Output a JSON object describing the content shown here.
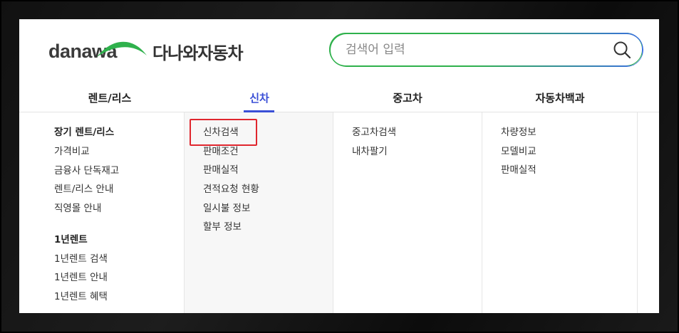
{
  "brand": {
    "logo_text": "danawa",
    "service_name": "다나와자동차",
    "swoosh_color": "#2fb14c"
  },
  "search": {
    "placeholder": "검색어 입력",
    "value": "",
    "icon": "search-icon",
    "border_colors": [
      "#2fb14c",
      "#3a6fe0"
    ]
  },
  "nav": {
    "tabs": [
      {
        "label": "렌트/리스",
        "active": false
      },
      {
        "label": "신차",
        "active": true
      },
      {
        "label": "중고차",
        "active": false
      },
      {
        "label": "자동차백과",
        "active": false
      }
    ],
    "active_color": "#3a4fd6"
  },
  "menu": {
    "rent": {
      "groups": [
        {
          "title": "장기 렌트/리스",
          "links": [
            "가격비교",
            "금융사 단독재고",
            "렌트/리스 안내",
            "직영몰 안내"
          ]
        },
        {
          "title": "1년렌트",
          "links": [
            "1년렌트 검색",
            "1년렌트 안내",
            "1년렌트 혜택"
          ]
        }
      ]
    },
    "newcar": {
      "links": [
        "신차검색",
        "판매조건",
        "판매실적",
        "견적요청 현황",
        "일시불 정보",
        "할부 정보"
      ],
      "highlighted": "신차검색",
      "highlight_color": "#e0262e"
    },
    "usedcar": {
      "links": [
        "중고차검색",
        "내차팔기"
      ]
    },
    "encyclopedia": {
      "links": [
        "차량정보",
        "모델비교",
        "판매실적"
      ]
    }
  }
}
